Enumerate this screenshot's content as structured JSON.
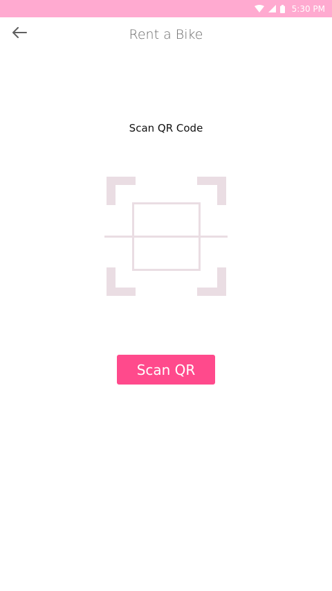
{
  "status_bar": {
    "time": "5:30 PM",
    "background_color": "#ffaad0",
    "icons": [
      "wifi-icon",
      "signal-icon",
      "battery-icon"
    ]
  },
  "app_bar": {
    "title": "Rent a Bike",
    "back_icon": "back-arrow-icon"
  },
  "main": {
    "heading": "Scan QR Code",
    "qr_icon": "qr-scan-frame-icon",
    "qr_frame_color": "#eadde3",
    "scan_button_label": "Scan QR",
    "accent_color": "#ff4a8c"
  }
}
